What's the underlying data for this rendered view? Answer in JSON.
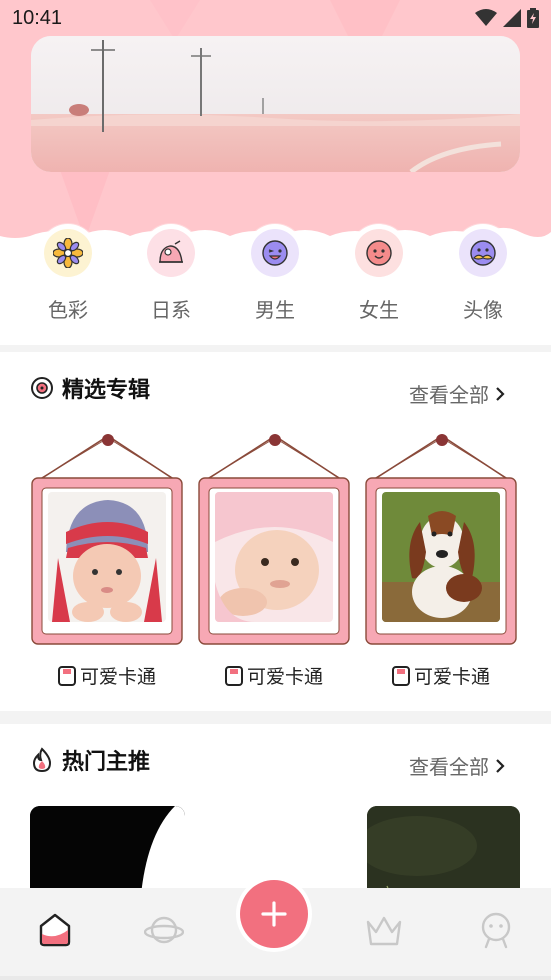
{
  "status_bar": {
    "time": "10:41"
  },
  "colors": {
    "accent": "#f2707f",
    "header_pink": "#ffc7cc",
    "icon_pink": "#f7a8b4"
  },
  "categories": [
    {
      "label": "色彩",
      "icon": "flower-icon",
      "bg": "#fdf3d2"
    },
    {
      "label": "日系",
      "icon": "hat-icon",
      "bg": "#fde0e6"
    },
    {
      "label": "男生",
      "icon": "boy-face-icon",
      "bg": "#ebe3fb"
    },
    {
      "label": "女生",
      "icon": "girl-face-icon",
      "bg": "#fde0e0"
    },
    {
      "label": "头像",
      "icon": "mustache-face-icon",
      "bg": "#ebe3fb"
    }
  ],
  "featured": {
    "title": "精选专辑",
    "more": "查看全部",
    "albums": [
      {
        "label": "可爱卡通",
        "photo": "baby-with-hat"
      },
      {
        "label": "可爱卡通",
        "photo": "baby-in-towel"
      },
      {
        "label": "可爱卡通",
        "photo": "basset-hound"
      }
    ]
  },
  "hot": {
    "title": "热门主推",
    "more": "查看全部"
  },
  "nav": [
    "home-icon",
    "planet-icon",
    "add-icon",
    "crown-icon",
    "profile-icon"
  ]
}
